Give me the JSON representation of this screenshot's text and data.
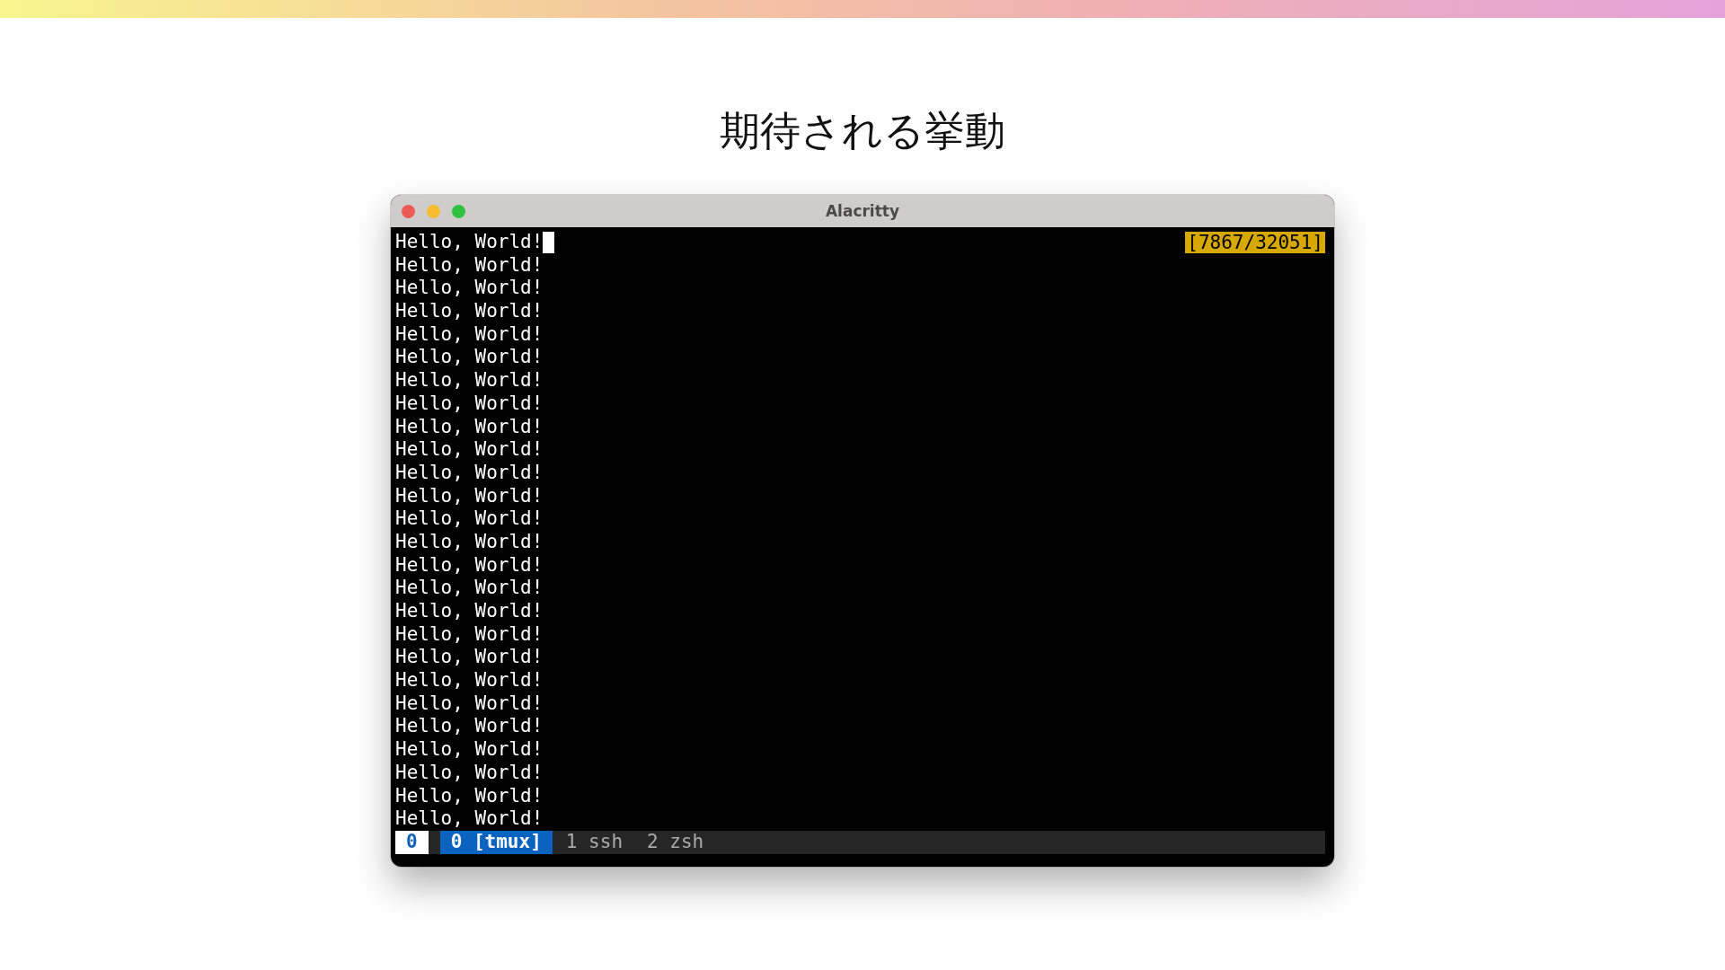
{
  "slide_title": "期待される挙動",
  "window": {
    "title": "Alacritty"
  },
  "terminal": {
    "scroll_position": "[7867/32051]",
    "lines": [
      {
        "text": "Hello, World!",
        "cursor": true
      },
      {
        "text": "Hello, World!",
        "cursor": false
      },
      {
        "text": "Hello, World!",
        "cursor": false
      },
      {
        "text": "Hello, World!",
        "cursor": false
      },
      {
        "text": "Hello, World!",
        "cursor": false
      },
      {
        "text": "Hello, World!",
        "cursor": false
      },
      {
        "text": "Hello, World!",
        "cursor": false
      },
      {
        "text": "Hello, World!",
        "cursor": false
      },
      {
        "text": "Hello, World!",
        "cursor": false
      },
      {
        "text": "Hello, World!",
        "cursor": false
      },
      {
        "text": "Hello, World!",
        "cursor": false
      },
      {
        "text": "Hello, World!",
        "cursor": false
      },
      {
        "text": "Hello, World!",
        "cursor": false
      },
      {
        "text": "Hello, World!",
        "cursor": false
      },
      {
        "text": "Hello, World!",
        "cursor": false
      },
      {
        "text": "Hello, World!",
        "cursor": false
      },
      {
        "text": "Hello, World!",
        "cursor": false
      },
      {
        "text": "Hello, World!",
        "cursor": false
      },
      {
        "text": "Hello, World!",
        "cursor": false
      },
      {
        "text": "Hello, World!",
        "cursor": false
      },
      {
        "text": "Hello, World!",
        "cursor": false
      },
      {
        "text": "Hello, World!",
        "cursor": false
      },
      {
        "text": "Hello, World!",
        "cursor": false
      },
      {
        "text": "Hello, World!",
        "cursor": false
      },
      {
        "text": "Hello, World!",
        "cursor": false
      },
      {
        "text": "Hello, World!",
        "cursor": false
      }
    ]
  },
  "status_bar": {
    "session": "0",
    "windows": [
      {
        "label": "0 [tmux]",
        "selected": true
      },
      {
        "label": "1 ssh",
        "selected": false
      },
      {
        "label": "2 zsh",
        "selected": false
      }
    ]
  }
}
